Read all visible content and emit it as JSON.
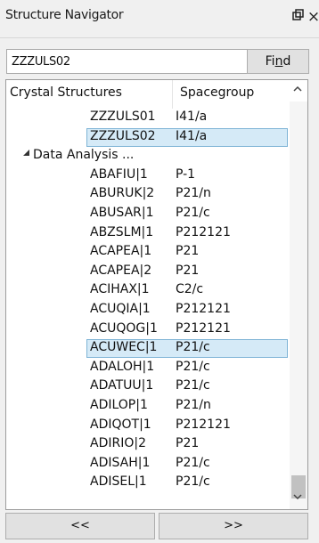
{
  "window": {
    "title": "Structure Navigator",
    "pin_glyph": "ȩ",
    "close_glyph": "×"
  },
  "search": {
    "value": "ZZZULS02",
    "find_label_pre": "Fi",
    "find_label_u": "n",
    "find_label_post": "d"
  },
  "tree": {
    "columns": [
      "Crystal Structures",
      "Spacegroup"
    ],
    "rows": [
      {
        "name": "ZZZULS01",
        "spacegroup": "I41/a",
        "selected": false,
        "group": false
      },
      {
        "name": "ZZZULS02",
        "spacegroup": "I41/a",
        "selected": true,
        "group": false
      },
      {
        "name": "Data Analysis ...",
        "spacegroup": "",
        "selected": false,
        "group": true
      },
      {
        "name": "ABAFIU|1",
        "spacegroup": "P-1",
        "selected": false,
        "group": false
      },
      {
        "name": "ABURUK|2",
        "spacegroup": "P21/n",
        "selected": false,
        "group": false
      },
      {
        "name": "ABUSAR|1",
        "spacegroup": "P21/c",
        "selected": false,
        "group": false
      },
      {
        "name": "ABZSLM|1",
        "spacegroup": "P212121",
        "selected": false,
        "group": false
      },
      {
        "name": "ACAPEA|1",
        "spacegroup": "P21",
        "selected": false,
        "group": false
      },
      {
        "name": "ACAPEA|2",
        "spacegroup": "P21",
        "selected": false,
        "group": false
      },
      {
        "name": "ACIHAX|1",
        "spacegroup": "C2/c",
        "selected": false,
        "group": false
      },
      {
        "name": "ACUQIA|1",
        "spacegroup": "P212121",
        "selected": false,
        "group": false
      },
      {
        "name": "ACUQOG|1",
        "spacegroup": "P212121",
        "selected": false,
        "group": false
      },
      {
        "name": "ACUWEC|1",
        "spacegroup": "P21/c",
        "selected": true,
        "group": false
      },
      {
        "name": "ADALOH|1",
        "spacegroup": "P21/c",
        "selected": false,
        "group": false
      },
      {
        "name": "ADATUU|1",
        "spacegroup": "P21/c",
        "selected": false,
        "group": false
      },
      {
        "name": "ADILOP|1",
        "spacegroup": "P21/n",
        "selected": false,
        "group": false
      },
      {
        "name": "ADIQOT|1",
        "spacegroup": "P212121",
        "selected": false,
        "group": false
      },
      {
        "name": "ADIRIO|2",
        "spacegroup": "P21",
        "selected": false,
        "group": false
      },
      {
        "name": "ADISAH|1",
        "spacegroup": "P21/c",
        "selected": false,
        "group": false
      },
      {
        "name": "ADISEL|1",
        "spacegroup": "P21/c",
        "selected": false,
        "group": false
      }
    ]
  },
  "nav": {
    "prev_label": "<<",
    "next_label": ">>"
  }
}
